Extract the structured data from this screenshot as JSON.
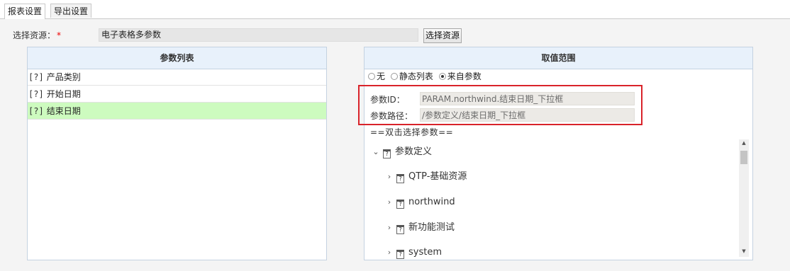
{
  "tabs": [
    {
      "label": "报表设置"
    },
    {
      "label": "导出设置"
    }
  ],
  "resource": {
    "label": "选择资源：",
    "required_mark": "*",
    "value": "电子表格多参数",
    "button_label": "选择资源"
  },
  "param_list": {
    "header": "参数列表",
    "items": [
      {
        "icon": "[?]",
        "label": "产品类别"
      },
      {
        "icon": "[?]",
        "label": "开始日期"
      },
      {
        "icon": "[?]",
        "label": "结束日期",
        "selected": true
      }
    ]
  },
  "value_range": {
    "header": "取值范围",
    "radio_options": [
      {
        "label": "无",
        "checked": false
      },
      {
        "label": "静态列表",
        "checked": false
      },
      {
        "label": "来自参数",
        "checked": true
      }
    ],
    "param_id_label": "参数ID：",
    "param_id_value": "PARAM.northwind.结束日期_下拉框",
    "param_path_label": "参数路径：",
    "param_path_value": "/参数定义/结束日期_下拉框",
    "hint": "==双击选择参数==",
    "tree": {
      "root": {
        "label": "参数定义",
        "icon": "param-folder-icon",
        "expanded": true
      },
      "children": [
        {
          "label": "QTP-基础资源",
          "icon": "param-folder-icon"
        },
        {
          "label": "northwind",
          "icon": "param-folder-icon"
        },
        {
          "label": "新功能测试",
          "icon": "param-folder-icon"
        },
        {
          "label": "system",
          "icon": "param-folder-icon"
        }
      ]
    }
  },
  "colors": {
    "selected_row": "#cdfbbf",
    "highlight_box": "#d9232a",
    "panel_header": "#e8f1fb"
  }
}
